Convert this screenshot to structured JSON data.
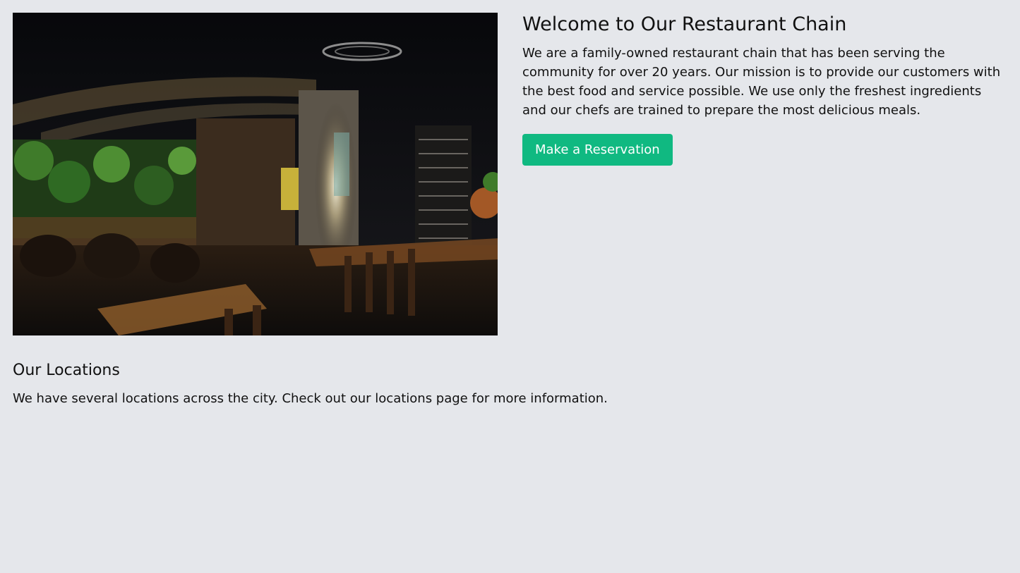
{
  "hero": {
    "image_alt": "Restaurant interior"
  },
  "intro": {
    "title": "Welcome to Our Restaurant Chain",
    "description": "We are a family-owned restaurant chain that has been serving the community for over 20 years. Our mission is to provide our customers with the best food and service possible. We use only the freshest ingredients and our chefs are trained to prepare the most delicious meals.",
    "cta_label": "Make a Reservation"
  },
  "locations": {
    "title": "Our Locations",
    "description": "We have several locations across the city. Check out our locations page for more information."
  },
  "colors": {
    "background": "#e5e7eb",
    "accent": "#10b981",
    "text": "#111111"
  }
}
